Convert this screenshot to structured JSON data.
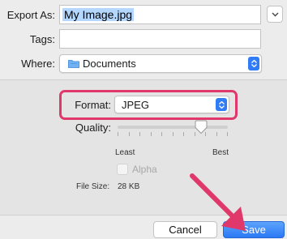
{
  "dialog": {
    "export_as": {
      "label": "Export As:",
      "value": "My Image.jpg"
    },
    "tags": {
      "label": "Tags:",
      "value": ""
    },
    "where": {
      "label": "Where:",
      "value": "Documents"
    },
    "format": {
      "label": "Format:",
      "value": "JPEG"
    },
    "quality": {
      "label": "Quality:",
      "min_label": "Least",
      "max_label": "Best",
      "level": 0.76
    },
    "alpha": {
      "label": "Alpha",
      "checked": false,
      "disabled": true
    },
    "file_size": {
      "label": "File Size:",
      "value": "28 KB"
    },
    "buttons": {
      "cancel": "Cancel",
      "save": "Save"
    }
  },
  "colors": {
    "accent": "#2f7cf6",
    "highlight": "#e0386b",
    "selection": "#b3d7ff"
  },
  "icons": {
    "expand": "chevron-down-icon",
    "folder": "folder-icon",
    "stepper": "stepper-arrows-icon",
    "annotation_arrow": "arrow-icon"
  }
}
